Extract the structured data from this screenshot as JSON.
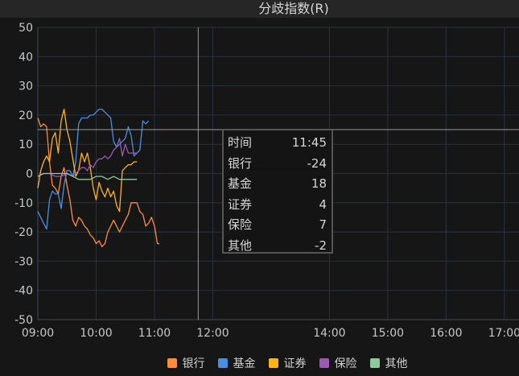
{
  "chart_data": {
    "type": "line",
    "title": "分歧指数(R)",
    "ylim": [
      -50,
      50
    ],
    "yticks": [
      50,
      40,
      30,
      20,
      10,
      0,
      -10,
      -20,
      -30,
      -40,
      -50
    ],
    "xlim": [
      "09:00",
      "17:15"
    ],
    "xticks": [
      "09:00",
      "10:00",
      "11:00",
      "12:00",
      "14:00",
      "15:00",
      "16:00",
      "17:00"
    ],
    "grid": true,
    "legend_position": "bottom",
    "series": [
      {
        "name": "银行",
        "color": "#ff8c3a",
        "points": [
          [
            "09:00",
            19
          ],
          [
            "09:03",
            16
          ],
          [
            "09:06",
            17
          ],
          [
            "09:09",
            16
          ],
          [
            "09:12",
            4
          ],
          [
            "09:15",
            -4
          ],
          [
            "09:18",
            -5
          ],
          [
            "09:21",
            -7
          ],
          [
            "09:24",
            -1
          ],
          [
            "09:27",
            2
          ],
          [
            "09:30",
            -4
          ],
          [
            "09:33",
            -9
          ],
          [
            "09:36",
            -16
          ],
          [
            "09:39",
            -18
          ],
          [
            "09:42",
            -15
          ],
          [
            "09:45",
            -16
          ],
          [
            "09:48",
            -18
          ],
          [
            "09:51",
            -19
          ],
          [
            "09:54",
            -21
          ],
          [
            "09:57",
            -22
          ],
          [
            "10:00",
            -24
          ],
          [
            "10:03",
            -23
          ],
          [
            "10:06",
            -25
          ],
          [
            "10:09",
            -24
          ],
          [
            "10:12",
            -20
          ],
          [
            "10:15",
            -18
          ],
          [
            "10:18",
            -16
          ],
          [
            "10:21",
            -18
          ],
          [
            "10:24",
            -20
          ],
          [
            "10:27",
            -18
          ],
          [
            "10:30",
            -16
          ],
          [
            "10:33",
            -14
          ],
          [
            "10:36",
            -10
          ],
          [
            "10:39",
            -10
          ],
          [
            "10:42",
            -10
          ],
          [
            "10:45",
            -13
          ],
          [
            "10:48",
            -14
          ],
          [
            "10:51",
            -18
          ],
          [
            "10:54",
            -17
          ],
          [
            "10:57",
            -15
          ],
          [
            "11:00",
            -18
          ],
          [
            "11:03",
            -24
          ],
          [
            "11:05",
            -24
          ]
        ]
      },
      {
        "name": "基金",
        "color": "#4a8ee0",
        "points": [
          [
            "09:00",
            -13
          ],
          [
            "09:03",
            -15
          ],
          [
            "09:06",
            -17
          ],
          [
            "09:09",
            -19
          ],
          [
            "09:12",
            -9
          ],
          [
            "09:15",
            -6
          ],
          [
            "09:18",
            -7
          ],
          [
            "09:21",
            -7
          ],
          [
            "09:24",
            -12
          ],
          [
            "09:27",
            -4
          ],
          [
            "09:30",
            1
          ],
          [
            "09:33",
            1
          ],
          [
            "09:36",
            -1
          ],
          [
            "09:39",
            4
          ],
          [
            "09:42",
            17
          ],
          [
            "09:45",
            19
          ],
          [
            "09:48",
            19
          ],
          [
            "09:51",
            19
          ],
          [
            "09:54",
            20
          ],
          [
            "09:57",
            20
          ],
          [
            "10:00",
            21
          ],
          [
            "10:03",
            22
          ],
          [
            "10:06",
            22
          ],
          [
            "10:09",
            21
          ],
          [
            "10:12",
            20
          ],
          [
            "10:15",
            19
          ],
          [
            "10:18",
            11
          ],
          [
            "10:21",
            9
          ],
          [
            "10:24",
            10
          ],
          [
            "10:27",
            11
          ],
          [
            "10:30",
            12
          ],
          [
            "10:33",
            16
          ],
          [
            "10:36",
            13
          ],
          [
            "10:39",
            6
          ],
          [
            "10:42",
            7
          ],
          [
            "10:45",
            8
          ],
          [
            "10:48",
            18
          ],
          [
            "10:51",
            17
          ],
          [
            "10:54",
            18
          ]
        ]
      },
      {
        "name": "证券",
        "color": "#ffb21c",
        "points": [
          [
            "09:00",
            -5
          ],
          [
            "09:03",
            1
          ],
          [
            "09:06",
            4
          ],
          [
            "09:09",
            6
          ],
          [
            "09:12",
            4
          ],
          [
            "09:15",
            12
          ],
          [
            "09:18",
            14
          ],
          [
            "09:21",
            7
          ],
          [
            "09:24",
            18
          ],
          [
            "09:27",
            22
          ],
          [
            "09:30",
            15
          ],
          [
            "09:33",
            11
          ],
          [
            "09:36",
            5
          ],
          [
            "09:39",
            -1
          ],
          [
            "09:42",
            1
          ],
          [
            "09:45",
            7
          ],
          [
            "09:48",
            4
          ],
          [
            "09:51",
            7
          ],
          [
            "09:54",
            2
          ],
          [
            "09:57",
            -5
          ],
          [
            "10:00",
            -9
          ],
          [
            "10:03",
            -3
          ],
          [
            "10:06",
            -6
          ],
          [
            "10:09",
            -8
          ],
          [
            "10:12",
            -5
          ],
          [
            "10:15",
            -8
          ],
          [
            "10:18",
            -6
          ],
          [
            "10:21",
            -11
          ],
          [
            "10:24",
            -13
          ],
          [
            "10:27",
            1
          ],
          [
            "10:30",
            2
          ],
          [
            "10:33",
            3
          ],
          [
            "10:36",
            3
          ],
          [
            "10:39",
            4
          ],
          [
            "10:42",
            4
          ]
        ]
      },
      {
        "name": "保险",
        "color": "#9b59b6",
        "points": [
          [
            "09:00",
            -1
          ],
          [
            "09:06",
            0
          ],
          [
            "09:12",
            0
          ],
          [
            "09:18",
            -1
          ],
          [
            "09:24",
            -1
          ],
          [
            "09:30",
            0
          ],
          [
            "09:36",
            -1
          ],
          [
            "09:42",
            1
          ],
          [
            "09:45",
            2
          ],
          [
            "09:48",
            2
          ],
          [
            "09:51",
            1
          ],
          [
            "09:54",
            3
          ],
          [
            "09:57",
            2
          ],
          [
            "10:00",
            4
          ],
          [
            "10:03",
            5
          ],
          [
            "10:06",
            5
          ],
          [
            "10:09",
            6
          ],
          [
            "10:12",
            5
          ],
          [
            "10:15",
            6
          ],
          [
            "10:18",
            8
          ],
          [
            "10:21",
            9
          ],
          [
            "10:24",
            12
          ],
          [
            "10:27",
            6
          ],
          [
            "10:30",
            10
          ],
          [
            "10:33",
            7
          ],
          [
            "10:36",
            7
          ],
          [
            "10:39",
            7
          ],
          [
            "10:42",
            7
          ]
        ]
      },
      {
        "name": "其他",
        "color": "#8fc89a",
        "points": [
          [
            "09:00",
            -1
          ],
          [
            "09:06",
            0
          ],
          [
            "09:12",
            0
          ],
          [
            "09:18",
            0
          ],
          [
            "09:24",
            0
          ],
          [
            "09:30",
            0
          ],
          [
            "09:36",
            -1
          ],
          [
            "09:42",
            -2
          ],
          [
            "09:48",
            -2
          ],
          [
            "09:54",
            -2
          ],
          [
            "10:00",
            -1
          ],
          [
            "10:06",
            -1
          ],
          [
            "10:12",
            -2
          ],
          [
            "10:18",
            -1
          ],
          [
            "10:24",
            -2
          ],
          [
            "10:30",
            -2
          ],
          [
            "10:36",
            -2
          ],
          [
            "10:42",
            -2
          ]
        ]
      }
    ],
    "cursor_time": "11:45",
    "tooltip": {
      "time_label": "时间",
      "time": "11:45",
      "rows": [
        {
          "name": "银行",
          "value": "-24"
        },
        {
          "name": "基金",
          "value": "18"
        },
        {
          "name": "证券",
          "value": "4"
        },
        {
          "name": "保险",
          "value": "7"
        },
        {
          "name": "其他",
          "value": "-2"
        }
      ]
    }
  }
}
